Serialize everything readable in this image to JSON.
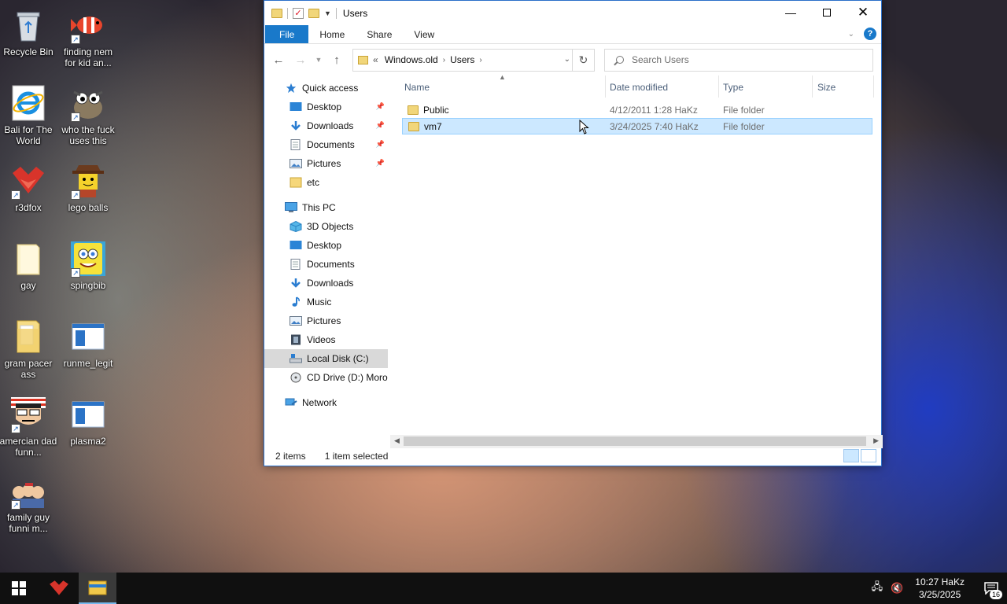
{
  "desktop": {
    "icons": [
      {
        "label": "Recycle Bin"
      },
      {
        "label": "finding nem for kid an..."
      },
      {
        "label": "Bali for The World"
      },
      {
        "label": "who the fuck uses this"
      },
      {
        "label": "r3dfox"
      },
      {
        "label": "lego balls"
      },
      {
        "label": "gay"
      },
      {
        "label": "spingbib"
      },
      {
        "label": "gram pacer ass"
      },
      {
        "label": "runme_legit"
      },
      {
        "label": "amercian dad funn..."
      },
      {
        "label": "plasma2"
      },
      {
        "label": "family guy funni m..."
      }
    ]
  },
  "window": {
    "title": "Users",
    "ribbon_tabs": [
      "File",
      "Home",
      "Share",
      "View"
    ],
    "address": {
      "overflow": "«",
      "crumbs": [
        "Windows.old",
        "Users"
      ]
    },
    "search_placeholder": "Search Users",
    "nav": {
      "quick_access": "Quick access",
      "quick_items": [
        "Desktop",
        "Downloads",
        "Documents",
        "Pictures",
        "etc"
      ],
      "this_pc": "This PC",
      "pc_items": [
        "3D Objects",
        "Desktop",
        "Documents",
        "Downloads",
        "Music",
        "Pictures",
        "Videos",
        "Local Disk (C:)",
        "CD Drive (D:) Moror"
      ],
      "network": "Network"
    },
    "columns": [
      "Name",
      "Date modified",
      "Type",
      "Size"
    ],
    "rows": [
      {
        "name": "Public",
        "date": "4/12/2011 1:28 HaKz",
        "type": "File folder",
        "size": ""
      },
      {
        "name": "vm7",
        "date": "3/24/2025 7:40 HaKz",
        "type": "File folder",
        "size": ""
      }
    ],
    "status": {
      "items": "2 items",
      "selected": "1 item selected"
    }
  },
  "taskbar": {
    "time": "10:27 HaKz",
    "date": "3/25/2025",
    "notification_count": "16"
  },
  "colors": {
    "accent": "#1979ca",
    "selection": "#cce8ff",
    "taskbar": "#101010"
  }
}
